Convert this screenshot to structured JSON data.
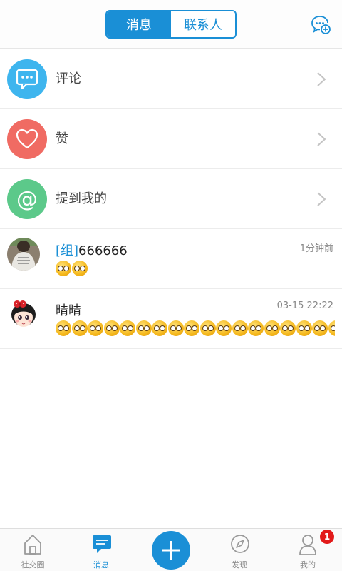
{
  "header": {
    "tabs": [
      {
        "label": "消息",
        "active": true
      },
      {
        "label": "联系人",
        "active": false
      }
    ],
    "new_chat_icon": "chat-plus-icon"
  },
  "categories": [
    {
      "label": "评论",
      "icon": "comment-bubble-icon",
      "color": "#3eb5ee"
    },
    {
      "label": "赞",
      "icon": "heart-icon",
      "color": "#f06b63"
    },
    {
      "label": "提到我的",
      "icon": "at-sign-icon",
      "color": "#5cc98a"
    }
  ],
  "conversations": [
    {
      "tag": "[组]",
      "name": "666666",
      "time": "1分钟前",
      "emoji_count": 2
    },
    {
      "tag": "",
      "name": "晴晴",
      "time": "03-15 22:22",
      "emoji_count": 18
    }
  ],
  "bottom_nav": {
    "items": [
      {
        "label": "社交圈",
        "icon": "home-icon",
        "active": false
      },
      {
        "label": "消息",
        "icon": "messages-icon",
        "active": true
      },
      {
        "label": "发现",
        "icon": "compass-icon",
        "active": false
      },
      {
        "label": "我的",
        "icon": "person-icon",
        "active": false
      }
    ],
    "center_button_icon": "plus-icon",
    "badge_count": "1"
  },
  "colors": {
    "accent": "#1a8fd6",
    "badge": "#e21a1a"
  }
}
